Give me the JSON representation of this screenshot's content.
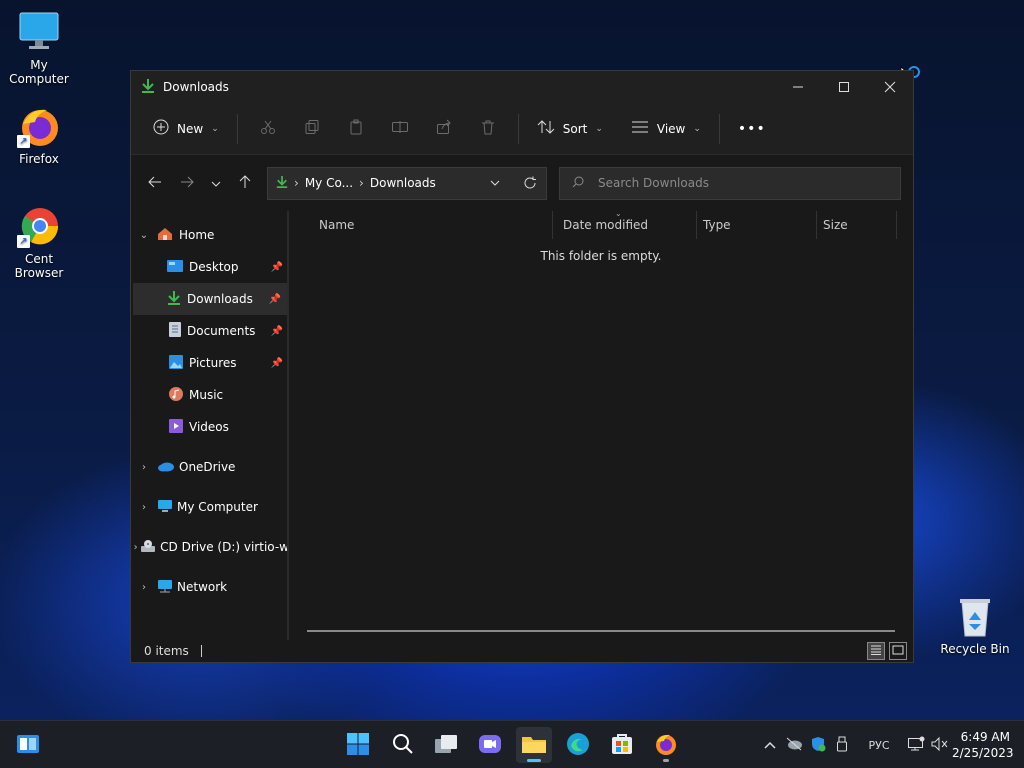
{
  "desktop": {
    "icons": [
      {
        "label": "My Computer"
      },
      {
        "label": "Firefox"
      },
      {
        "label": "Cent Browser"
      },
      {
        "label": "Recycle Bin"
      }
    ]
  },
  "window": {
    "title": "Downloads",
    "toolbar": {
      "new_label": "New",
      "sort_label": "Sort",
      "view_label": "View",
      "more_label": "•••"
    },
    "address": {
      "crumbs": [
        "My Co...",
        "Downloads"
      ]
    },
    "search": {
      "placeholder": "Search Downloads"
    },
    "sidebar": {
      "home": "Home",
      "items": [
        {
          "label": "Desktop",
          "pinned": true
        },
        {
          "label": "Downloads",
          "pinned": true
        },
        {
          "label": "Documents",
          "pinned": true
        },
        {
          "label": "Pictures",
          "pinned": true
        },
        {
          "label": "Music",
          "pinned": false
        },
        {
          "label": "Videos",
          "pinned": false
        }
      ],
      "roots": [
        {
          "label": "OneDrive"
        },
        {
          "label": "My Computer"
        },
        {
          "label": "CD Drive (D:) virtio-w"
        },
        {
          "label": "Network"
        }
      ]
    },
    "columns": [
      "Name",
      "Date modified",
      "Type",
      "Size"
    ],
    "empty_message": "This folder is empty.",
    "status": {
      "items": "0 items"
    }
  },
  "taskbar": {
    "tray": {
      "language": "РУС"
    },
    "clock": {
      "time": "6:49 AM",
      "date": "2/25/2023"
    }
  },
  "colors": {
    "accent_green": "#3fb950",
    "folder_yellow": "#f5c242",
    "windows_blue": "#2b8fe8"
  }
}
